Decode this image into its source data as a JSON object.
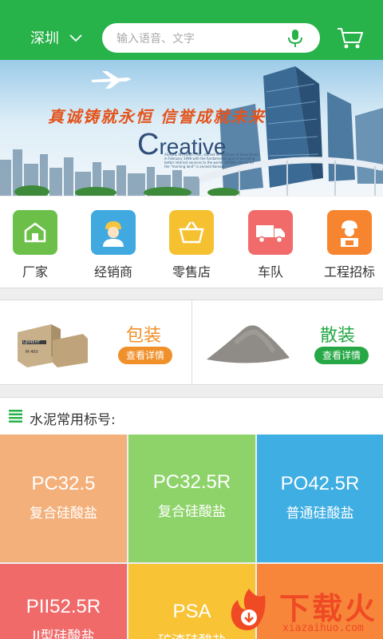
{
  "header": {
    "city": "深圳",
    "search_placeholder": "输入语音、文字"
  },
  "banner": {
    "slogan": "真诚铸就永恒  信誉成就未来",
    "brand_initial": "C",
    "brand_rest": "reative",
    "small_text": "ASADAL INTERNET, INC. started its business in Seoul Korea in February 1998 with the fundamental goal of providing better internet services to the world. ASADAL stands for the \"morning land\" in ancient Korean."
  },
  "categories": [
    {
      "label": "厂家",
      "color": "#6cc04a",
      "icon": "factory-icon"
    },
    {
      "label": "经销商",
      "color": "#3fa9e0",
      "icon": "dealer-icon"
    },
    {
      "label": "零售店",
      "color": "#f6c131",
      "icon": "basket-icon"
    },
    {
      "label": "车队",
      "color": "#f16b6b",
      "icon": "truck-icon"
    },
    {
      "label": "工程招标",
      "color": "#f7852f",
      "icon": "engineer-icon"
    }
  ],
  "products": [
    {
      "title": "包装",
      "button": "查看详情",
      "color": "#f0902a"
    },
    {
      "title": "散装",
      "button": "查看详情",
      "color": "#25a845"
    }
  ],
  "product_image_labels": {
    "bag_text": "ЦЕМЕНТ",
    "bag_code": "M-400"
  },
  "section": {
    "title": "水泥常用标号:"
  },
  "grades": [
    {
      "code": "PC32.5",
      "name": "复合硅酸盐",
      "color": "#f4b07b"
    },
    {
      "code": "PC32.5R",
      "name": "复合硅酸盐",
      "color": "#8ed36a"
    },
    {
      "code": "PO42.5R",
      "name": "普通硅酸盐",
      "color": "#3faee3"
    },
    {
      "code": "PII52.5R",
      "name": "II型硅酸盐",
      "color": "#f06a6a"
    },
    {
      "code": "PSA",
      "name": "矿渣硅酸盐",
      "color": "#f8c334"
    },
    {
      "code": "",
      "name": "",
      "color": "#f7853a"
    }
  ],
  "watermark": {
    "text": "下载火",
    "url": "xiazaihuo.com"
  }
}
